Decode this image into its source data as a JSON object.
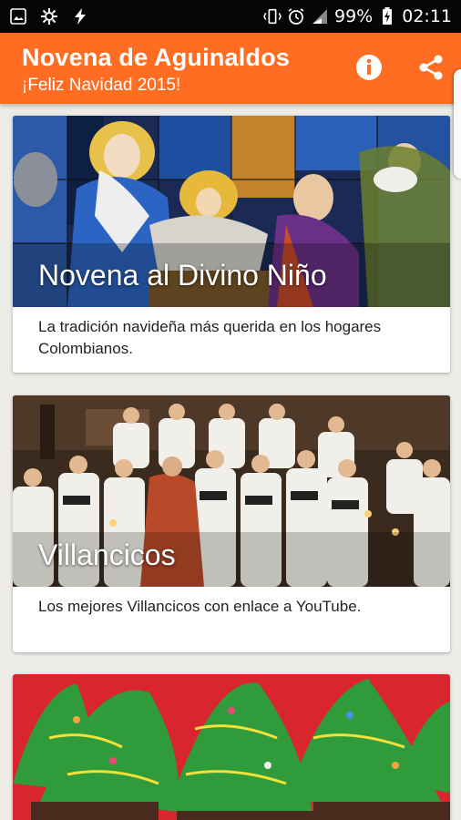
{
  "status_bar": {
    "battery_percent": "99%",
    "time": "02:11"
  },
  "app_bar": {
    "title": "Novena de Aguinaldos",
    "subtitle": "¡Feliz Navidad 2015!",
    "info_icon": "info-icon",
    "share_icon": "share-icon"
  },
  "cards": [
    {
      "title": "Novena al Divino Niño",
      "description": "La tradición navideña más querida en los hogares Colombianos."
    },
    {
      "title": "Villancicos",
      "description": "Los mejores Villancicos con enlace a YouTube."
    }
  ],
  "colors": {
    "accent": "#ff6d22",
    "status_bar": "#050505",
    "background": "#ecebe6"
  }
}
